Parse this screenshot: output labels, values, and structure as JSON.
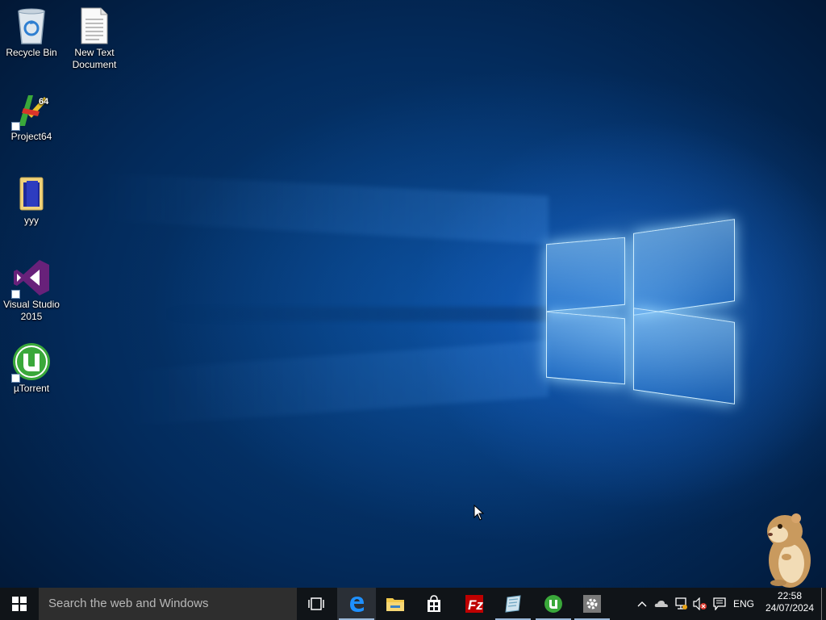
{
  "desktop": {
    "icons": [
      {
        "label": "Recycle Bin",
        "icon": "recycle-bin-icon"
      },
      {
        "label": "New Text Document",
        "icon": "text-document-icon"
      },
      {
        "label": "Project64",
        "icon": "project64-icon"
      },
      {
        "label": "yyy",
        "icon": "folder-icon"
      },
      {
        "label": "Visual Studio 2015",
        "icon": "visual-studio-icon"
      },
      {
        "label": "µTorrent",
        "icon": "utorrent-icon"
      }
    ]
  },
  "taskbar": {
    "search_placeholder": "Search the web and Windows",
    "apps": [
      "task-view-icon",
      "edge-icon",
      "file-explorer-icon",
      "store-icon",
      "filezilla-icon",
      "notepad-icon",
      "utorrent-icon",
      "settings-icon"
    ],
    "tray": {
      "language": "ENG",
      "time": "22:58",
      "date": "24/07/2024"
    }
  },
  "colors": {
    "taskbar": "#101418",
    "search_box": "#2e2e2e",
    "accent": "#1e90ff"
  }
}
